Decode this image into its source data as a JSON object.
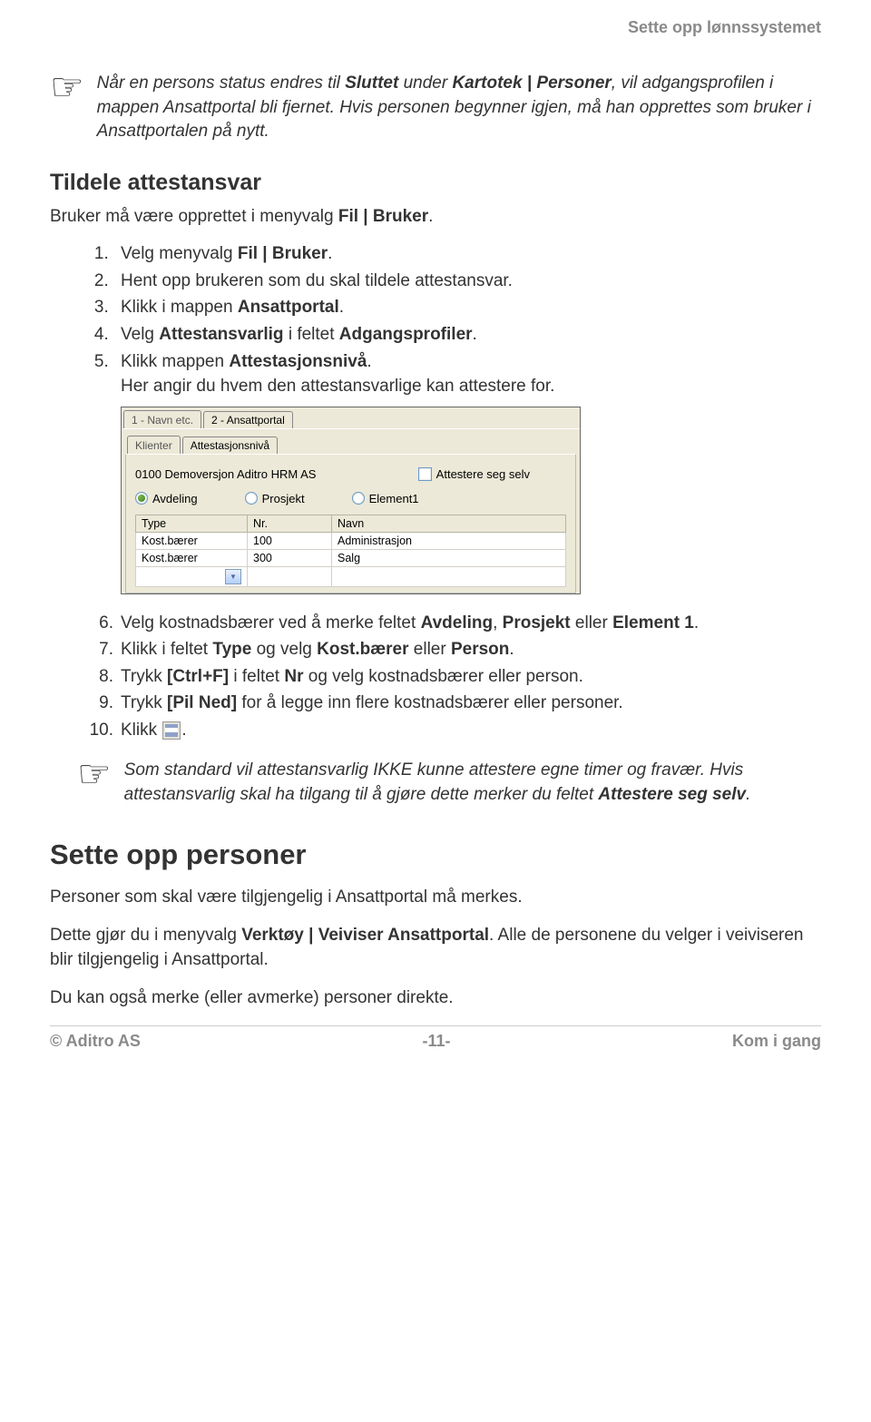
{
  "header": {
    "title": "Sette opp lønnssystemet"
  },
  "note1": {
    "text_part1": "Når en persons status endres til ",
    "bold1": "Sluttet",
    "text_part2": " under ",
    "bold2": "Kartotek | Personer",
    "text_part3": ", vil adgangsprofilen i mappen Ansattportal bli fjernet. Hvis personen begynner igjen, må han opprettes som bruker i Ansattportalen på nytt."
  },
  "section1": {
    "heading": "Tildele attestansvar",
    "intro_part1": "Bruker må være opprettet i menyvalg ",
    "intro_bold": "Fil | Bruker",
    "intro_part2": ".",
    "steps": {
      "s1a": "Velg menyvalg ",
      "s1b": "Fil | Bruker",
      "s1c": ".",
      "s2": "Hent opp brukeren som du skal tildele attestansvar.",
      "s3a": "Klikk i mappen ",
      "s3b": "Ansattportal",
      "s3c": ".",
      "s4a": "Velg ",
      "s4b": "Attestansvarlig",
      "s4c": " i feltet ",
      "s4d": "Adgangsprofiler",
      "s4e": ".",
      "s5a": "Klikk mappen ",
      "s5b": "Attestasjonsnivå",
      "s5c": ".",
      "s5sub": "Her angir du hvem den attestansvarlige kan attestere for."
    }
  },
  "screenshot": {
    "tab1": "1 - Navn etc.",
    "tab2": "2 - Ansattportal",
    "subtab1": "Klienter",
    "subtab2": "Attestasjonsnivå",
    "client": "0100 Demoversjon Aditro HRM AS",
    "checkbox_label": "Attestere seg selv",
    "radio1": "Avdeling",
    "radio2": "Prosjekt",
    "radio3": "Element1",
    "headers": {
      "type": "Type",
      "nr": "Nr.",
      "navn": "Navn"
    },
    "rows": [
      {
        "type": "Kost.bærer",
        "nr": "100",
        "navn": "Administrasjon"
      },
      {
        "type": "Kost.bærer",
        "nr": "300",
        "navn": "Salg"
      }
    ]
  },
  "section1b": {
    "s6a": "Velg kostnadsbærer ved å merke feltet ",
    "s6b": "Avdeling",
    "s6c": ", ",
    "s6d": "Prosjekt",
    "s6e": " eller ",
    "s6f": "Element 1",
    "s6g": ".",
    "s7a": "Klikk i feltet ",
    "s7b": "Type",
    "s7c": " og velg ",
    "s7d": "Kost.bærer",
    "s7e": " eller ",
    "s7f": "Person",
    "s7g": ".",
    "s8a": "Trykk ",
    "s8b": "[Ctrl+F]",
    "s8c": " i feltet ",
    "s8d": "Nr",
    "s8e": " og velg kostnadsbærer eller person.",
    "s9a": "Trykk ",
    "s9b": "[Pil Ned]",
    "s9c": " for å legge inn flere kostnadsbærer eller personer.",
    "s10a": "Klikk ",
    "s10b": "."
  },
  "note2": {
    "t1": "Som standard vil attestansvarlig IKKE kunne attestere egne timer og fravær. Hvis attestansvarlig skal ha tilgang til å gjøre dette merker du feltet ",
    "b1": "Attestere seg selv",
    "t2": "."
  },
  "section2": {
    "heading": "Sette opp personer",
    "p1": "Personer som skal være tilgjengelig i Ansattportal må merkes.",
    "p2a": "Dette gjør du i menyvalg ",
    "p2b": "Verktøy | Veiviser Ansattportal",
    "p2c": ". Alle de personene du velger i veiviseren blir tilgjengelig i Ansattportal.",
    "p3": "Du kan også merke (eller avmerke) personer direkte."
  },
  "footer": {
    "left": "© Aditro AS",
    "center": "-11-",
    "right": "Kom i gang"
  }
}
